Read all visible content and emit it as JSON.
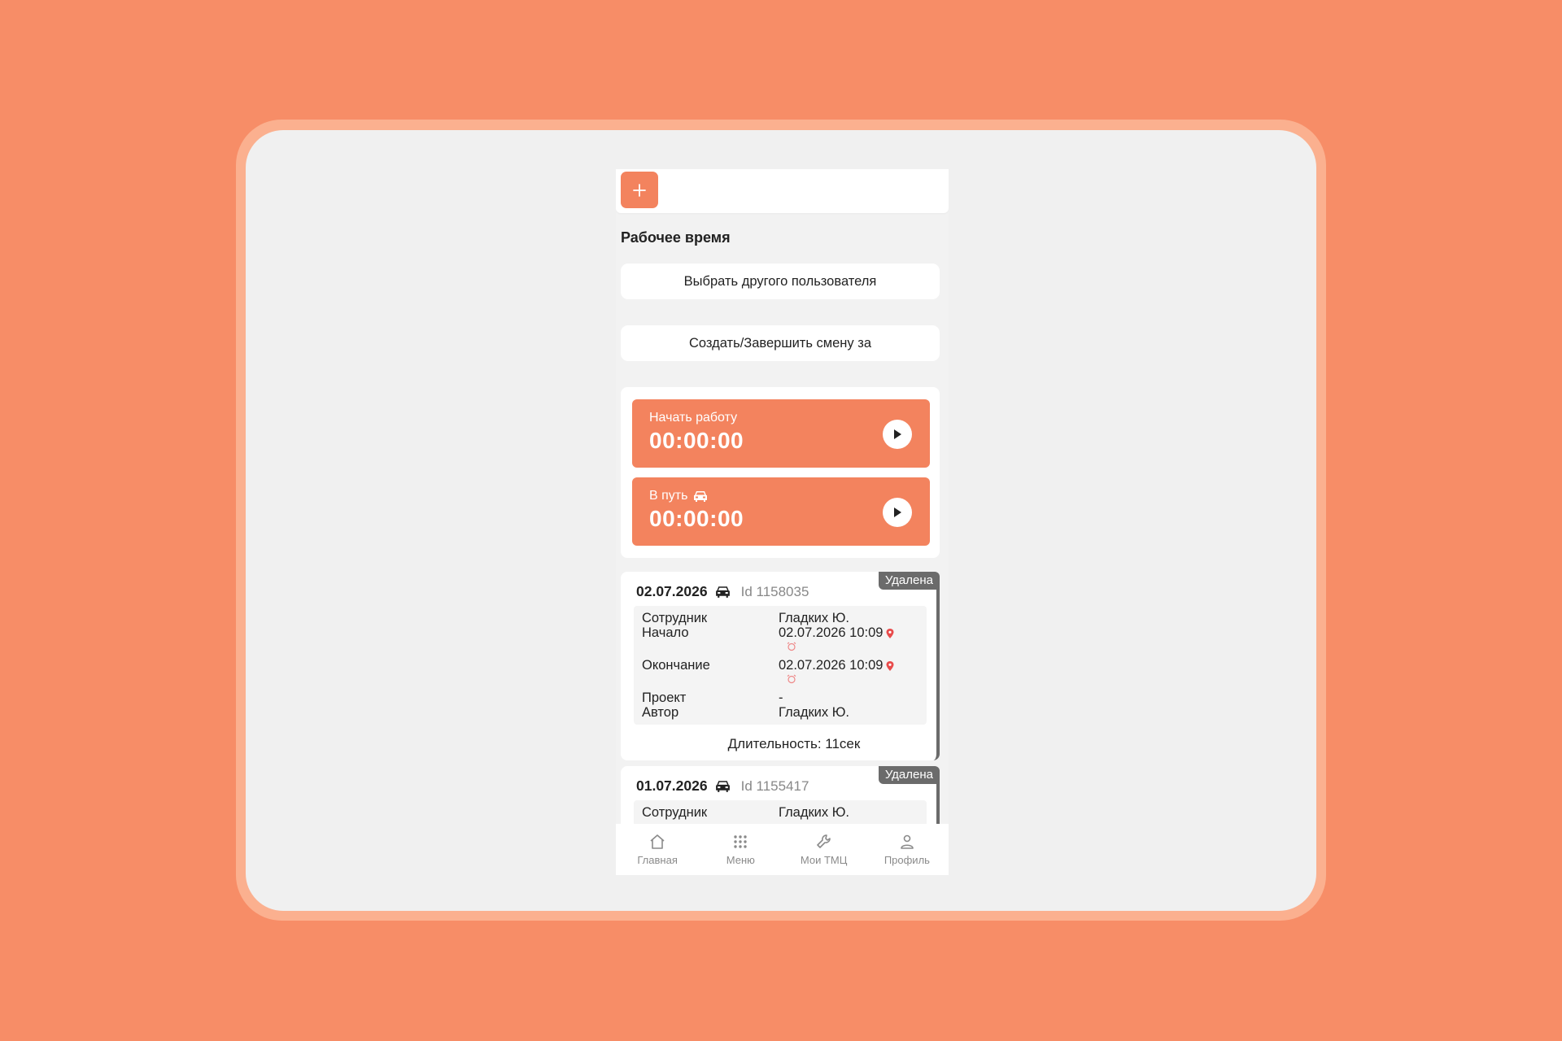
{
  "header": {
    "add_icon": "plus-icon",
    "accent": "#F3835E"
  },
  "page": {
    "title": "Рабочее время"
  },
  "actions": {
    "choose_user": "Выбрать другого пользователя",
    "shift": "Создать/Завершить смену за"
  },
  "timers": [
    {
      "label": "Начать работу",
      "value": "00:00:00",
      "icon": "play-icon"
    },
    {
      "label": "В путь",
      "value": "00:00:00",
      "icon": "car-icon"
    }
  ],
  "entries": [
    {
      "date": "02.07.2026",
      "id": "Id 1158035",
      "status": "Удалена",
      "employee_label": "Сотрудник",
      "employee": "Гладких Ю.",
      "start_label": "Начало",
      "start": "02.07.2026 10:09",
      "end_label": "Окончание",
      "end": "02.07.2026 10:09",
      "project_label": "Проект",
      "project": "-",
      "author_label": "Автор",
      "author": "Гладких Ю.",
      "duration": "Длительность: 11сек"
    },
    {
      "date": "01.07.2026",
      "id": "Id 1155417",
      "status": "Удалена",
      "employee_label": "Сотрудник",
      "employee": "Гладких Ю."
    }
  ],
  "nav": [
    {
      "label": "Главная",
      "icon": "home-icon"
    },
    {
      "label": "Меню",
      "icon": "grid-icon"
    },
    {
      "label": "Мои ТМЦ",
      "icon": "wrench-icon"
    },
    {
      "label": "Профиль",
      "icon": "user-icon"
    }
  ]
}
